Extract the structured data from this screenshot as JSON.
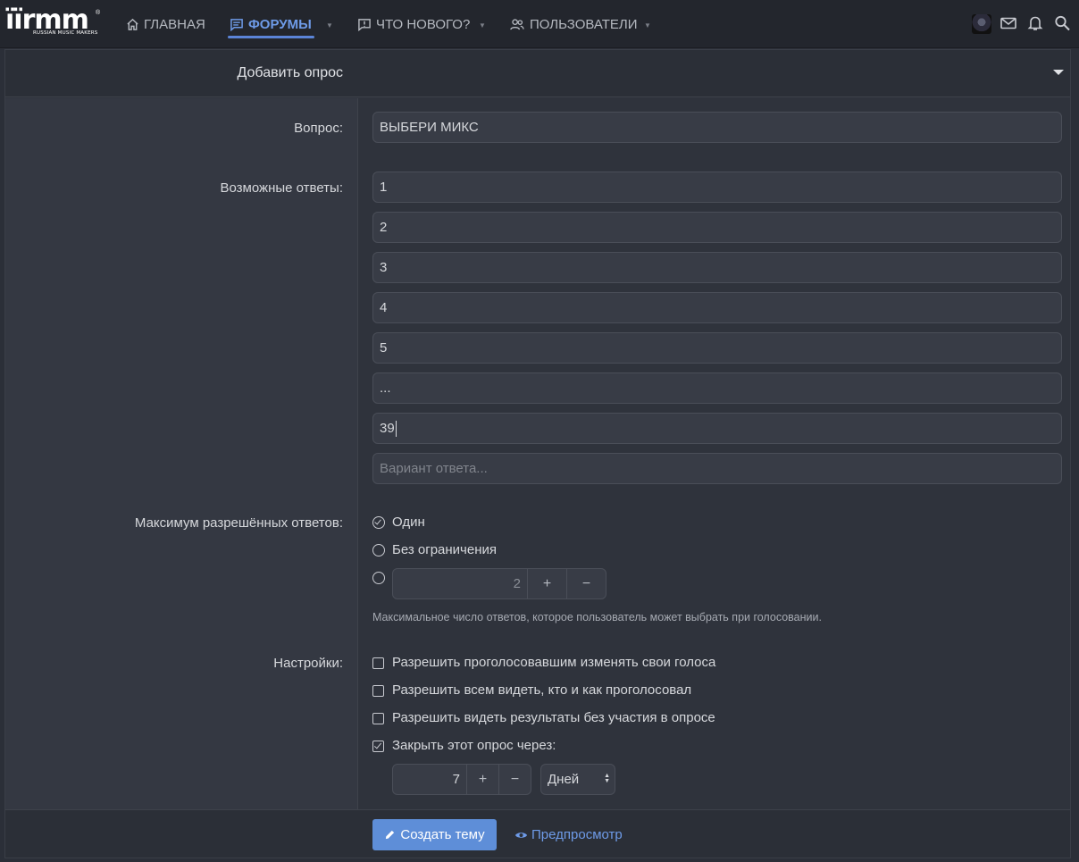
{
  "logo": {
    "main": "ïïrmm",
    "sub": "RUSSIAN MUSIC MAKERS",
    "reg": "®"
  },
  "nav": [
    {
      "label": "Главная",
      "icon": "home-icon"
    },
    {
      "label": "Форумы",
      "icon": "forum-icon",
      "active": true
    },
    {
      "label": "Что нового?",
      "icon": "whats-new-icon"
    },
    {
      "label": "Пользователи",
      "icon": "users-icon"
    }
  ],
  "panel": {
    "title": "Добавить опрос"
  },
  "question": {
    "label": "Вопрос:",
    "value": "ВЫБЕРИ МИКС"
  },
  "answers": {
    "label": "Возможные ответы:",
    "values": [
      "1",
      "2",
      "3",
      "4",
      "5",
      "...",
      "39"
    ],
    "placeholder": "Вариант ответа..."
  },
  "max_answers": {
    "label": "Максимум разрешённых ответов:",
    "options": [
      "Один",
      "Без ограничения"
    ],
    "selected": "Один",
    "custom_value": "2",
    "hint": "Максимальное число ответов, которое пользователь может выбрать при голосовании."
  },
  "settings": {
    "label": "Настройки:",
    "options": [
      {
        "label": "Разрешить проголосовавшим изменять свои голоса",
        "checked": false
      },
      {
        "label": "Разрешить всем видеть, кто и как проголосовал",
        "checked": false
      },
      {
        "label": "Разрешить видеть результаты без участия в опросе",
        "checked": false
      },
      {
        "label": "Закрыть этот опрос через:",
        "checked": true
      }
    ],
    "close_after_value": "7",
    "close_after_unit": "Дней"
  },
  "buttons": {
    "plus": "+",
    "minus": "−",
    "submit": "Создать тему",
    "preview": "Предпросмотр"
  },
  "colors": {
    "accent": "#5e8ed8",
    "link": "#6e9be8",
    "background": "#2f333c"
  }
}
